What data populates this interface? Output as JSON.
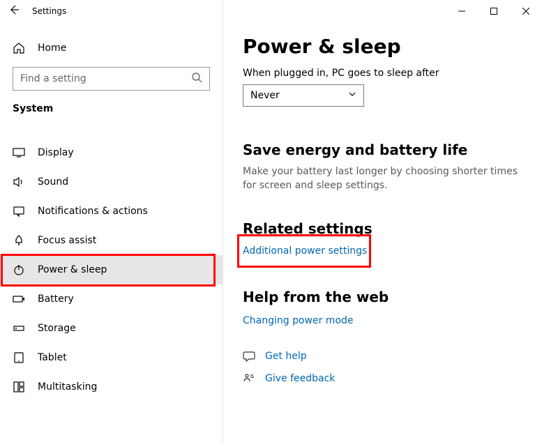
{
  "titlebar": {
    "title": "Settings"
  },
  "sidebar": {
    "home_label": "Home",
    "search_placeholder": "Find a setting",
    "section_label": "System",
    "items": [
      {
        "label": "Display"
      },
      {
        "label": "Sound"
      },
      {
        "label": "Notifications & actions"
      },
      {
        "label": "Focus assist"
      },
      {
        "label": "Power & sleep"
      },
      {
        "label": "Battery"
      },
      {
        "label": "Storage"
      },
      {
        "label": "Tablet"
      },
      {
        "label": "Multitasking"
      }
    ]
  },
  "main": {
    "title": "Power & sleep",
    "sleep_label": "When plugged in, PC goes to sleep after",
    "sleep_value": "Never",
    "energy_heading": "Save energy and battery life",
    "energy_desc": "Make your battery last longer by choosing shorter times for screen and sleep settings.",
    "related_heading": "Related settings",
    "related_link": "Additional power settings",
    "help_heading": "Help from the web",
    "help_link": "Changing power mode",
    "get_help": "Get help",
    "give_feedback": "Give feedback"
  }
}
